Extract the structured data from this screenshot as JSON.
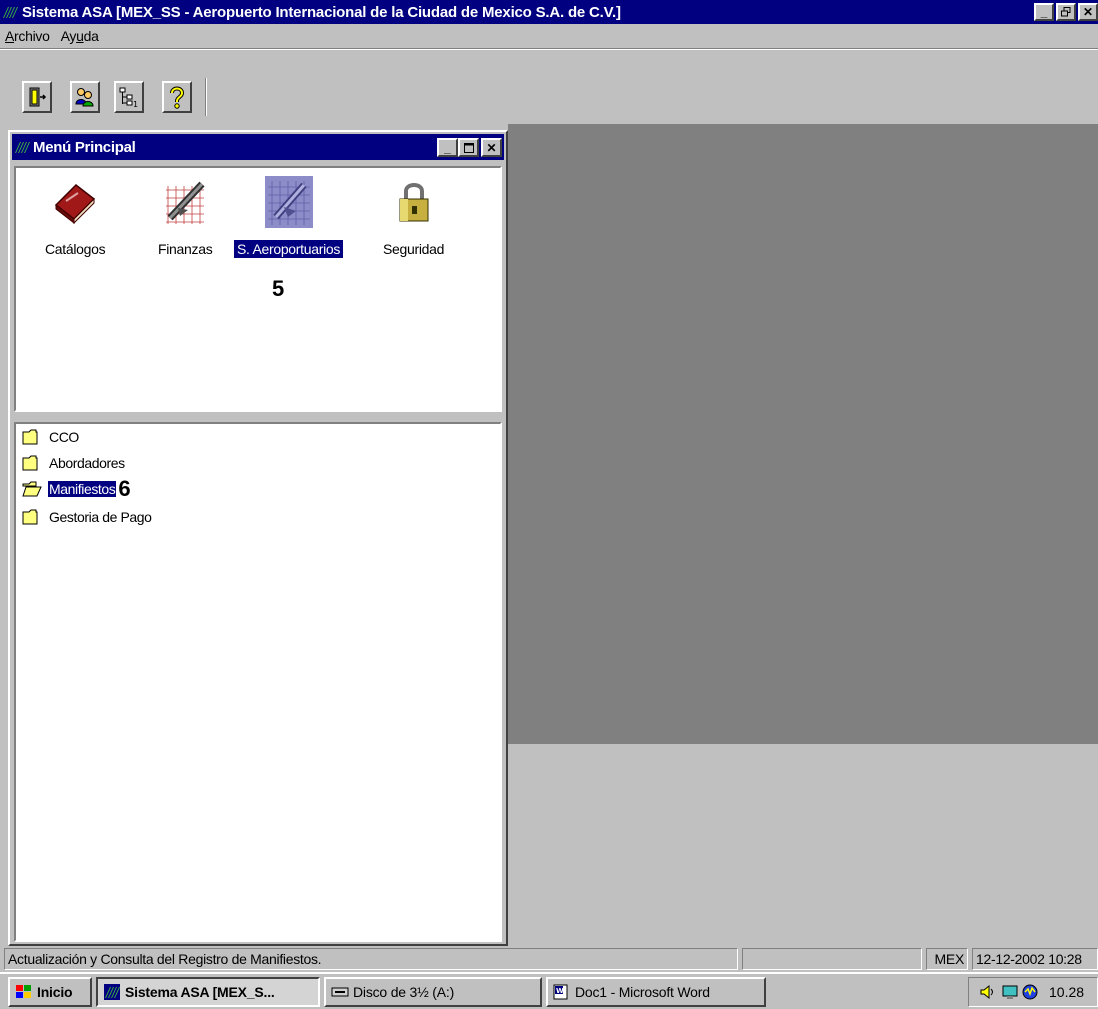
{
  "window": {
    "title": "Sistema ASA [MEX_SS - Aeropuerto Internacional de la Ciudad de Mexico S.A. de C.V.]"
  },
  "menu": {
    "items": [
      {
        "label": "Archivo",
        "accel": "A"
      },
      {
        "label": "Ayuda",
        "accel": "u"
      }
    ]
  },
  "toolbar": {
    "buttons": [
      {
        "icon": "exit-door-icon"
      },
      {
        "icon": "users-icon"
      },
      {
        "icon": "tree-view-icon"
      },
      {
        "icon": "help-icon"
      }
    ]
  },
  "child_window": {
    "title": "Menú Principal",
    "modules": [
      {
        "label": "Catálogos",
        "icon": "book-icon",
        "selected": false
      },
      {
        "label": "Finanzas",
        "icon": "finance-chart-icon",
        "selected": false
      },
      {
        "label": "S. Aeroportuarios",
        "icon": "airplane-icon",
        "selected": true
      },
      {
        "label": "Seguridad",
        "icon": "padlock-icon",
        "selected": false
      }
    ],
    "tree": [
      {
        "label": "CCO",
        "open": false,
        "selected": false
      },
      {
        "label": "Abordadores",
        "open": false,
        "selected": false
      },
      {
        "label": "Manifiestos",
        "open": true,
        "selected": true
      },
      {
        "label": "Gestoria de Pago",
        "open": false,
        "selected": false
      }
    ]
  },
  "annotations": {
    "step5": "5",
    "step6": "6"
  },
  "statusbar": {
    "message": "Actualización y Consulta del Registro de Manifiestos.",
    "airport": "MEX",
    "datetime": "12-12-2002 10:28"
  },
  "taskbar": {
    "start": "Inicio",
    "tasks": [
      {
        "label": "Sistema ASA [MEX_S...",
        "active": true
      },
      {
        "label": "Disco de 3½ (A:)",
        "active": false
      },
      {
        "label": "Doc1 - Microsoft Word",
        "active": false
      }
    ],
    "clock": "10.28"
  }
}
